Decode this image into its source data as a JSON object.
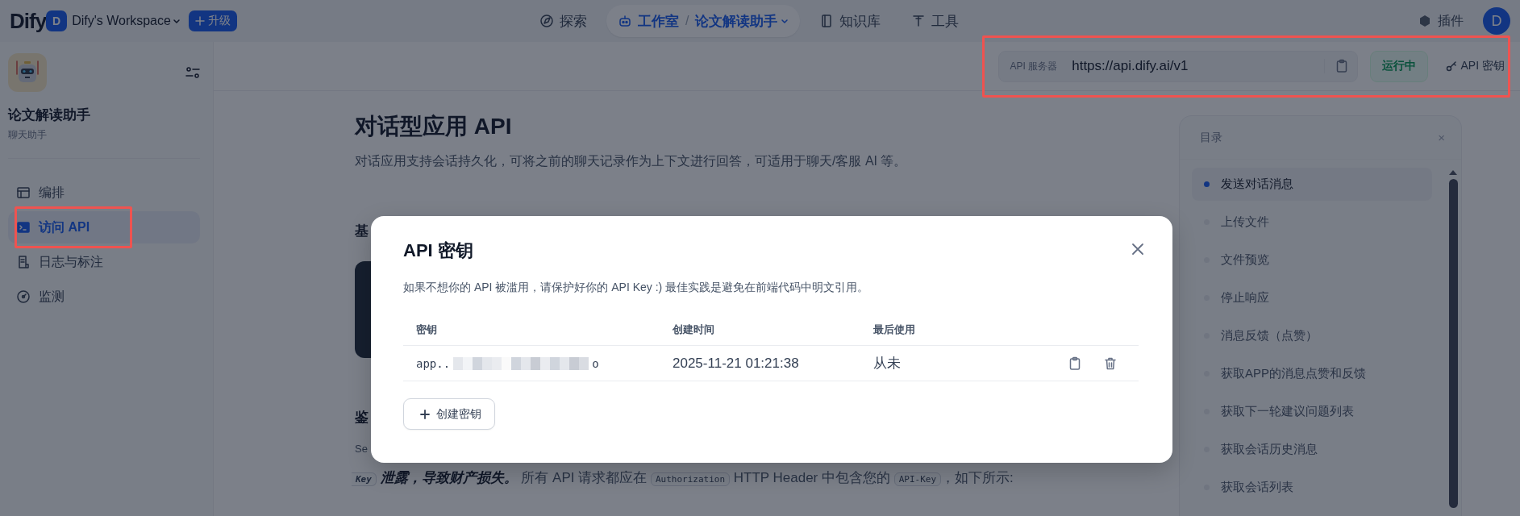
{
  "topbar": {
    "logo": "Dify",
    "workspace_avatar": "D",
    "workspace": "Dify's Workspace",
    "upgrade": "升级",
    "nav": [
      {
        "label": "探索",
        "selected": false
      },
      {
        "label": "工作室",
        "selected": true,
        "separator": "/",
        "breadcrumb": "论文解读助手"
      },
      {
        "label": "知识库",
        "selected": false
      },
      {
        "label": "工具",
        "selected": false
      }
    ],
    "plugins": "插件",
    "user_avatar": "D"
  },
  "sidebar": {
    "app_name": "论文解读助手",
    "app_type": "聊天助手",
    "items": [
      {
        "label": "编排",
        "selected": false
      },
      {
        "label": "访问 API",
        "selected": true
      },
      {
        "label": "日志与标注",
        "selected": false
      },
      {
        "label": "监测",
        "selected": false
      }
    ]
  },
  "header": {
    "server_label": "API 服务器",
    "server_url": "https://api.dify.ai/v1",
    "status": "运行中",
    "api_key_button": "API 密钥"
  },
  "content": {
    "title": "对话型应用 API",
    "description": "对话应用支持会话持久化，可将之前的聊天记录作为上下文进行回答，可适用于聊天/客服 AI 等。",
    "heading_1": "基",
    "heading_2": "鉴",
    "text_fragment": "Se",
    "last_line": [
      {
        "kind": "code",
        "text": "Key"
      },
      {
        "kind": "strong",
        "text": " 泄露，导致财产损失。"
      },
      {
        "kind": "plain",
        "text": " 所有 API 请求都应在 "
      },
      {
        "kind": "code",
        "text": "Authorization"
      },
      {
        "kind": "plain",
        "text": " HTTP Header 中包含您的 "
      },
      {
        "kind": "code",
        "text": "API-Key"
      },
      {
        "kind": "plain",
        "text": "，如下所示:"
      }
    ]
  },
  "toc": {
    "title": "目录",
    "close": "×",
    "items": [
      {
        "label": "发送对话消息",
        "selected": true
      },
      {
        "label": "上传文件",
        "selected": false
      },
      {
        "label": "文件预览",
        "selected": false
      },
      {
        "label": "停止响应",
        "selected": false
      },
      {
        "label": "消息反馈（点赞）",
        "selected": false
      },
      {
        "label": "获取APP的消息点赞和反馈",
        "selected": false
      },
      {
        "label": "获取下一轮建议问题列表",
        "selected": false
      },
      {
        "label": "获取会话历史消息",
        "selected": false
      },
      {
        "label": "获取会话列表",
        "selected": false
      }
    ]
  },
  "modal": {
    "title": "API 密钥",
    "description": "如果不想你的 API 被滥用，请保护好你的 API Key :) 最佳实践是避免在前端代码中明文引用。",
    "columns": [
      "密钥",
      "创建时间",
      "最后使用"
    ],
    "rows": [
      {
        "key_prefix": "app..",
        "key_suffix": "o",
        "created": "2025-11-21 01:21:38",
        "last_used": "从未"
      }
    ],
    "create_button": "创建密钥"
  }
}
